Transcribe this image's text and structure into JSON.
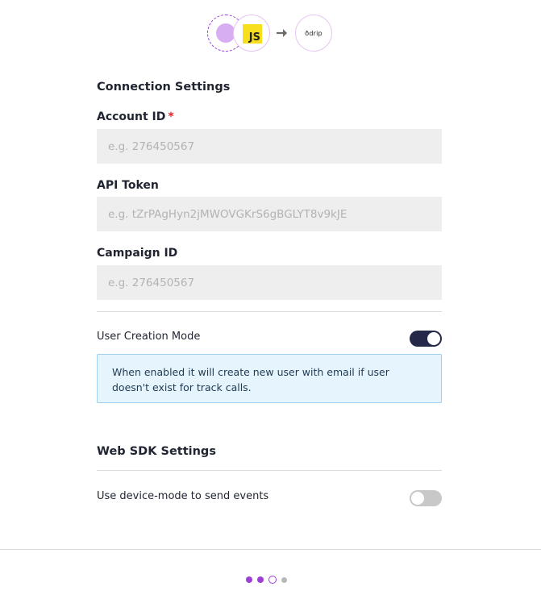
{
  "header": {
    "source_icon": "source-placeholder-icon",
    "source_badge": "JS",
    "arrow_icon": "arrow-right-icon",
    "destination_logo_text": "ðdrip"
  },
  "connection_settings": {
    "title": "Connection Settings",
    "account_id": {
      "label": "Account ID",
      "required_mark": "*",
      "value": "",
      "placeholder": "e.g. 276450567"
    },
    "api_token": {
      "label": "API Token",
      "value": "",
      "placeholder": "e.g. tZrPAgHyn2jMWOVGKrS6gBGLYT8v9kJE"
    },
    "campaign_id": {
      "label": "Campaign ID",
      "value": "",
      "placeholder": "e.g. 276450567"
    },
    "user_creation_mode": {
      "label": "User Creation Mode",
      "enabled": true,
      "info": "When enabled it will create new user with email if user doesn't exist for track calls."
    }
  },
  "web_sdk_settings": {
    "title": "Web SDK Settings",
    "device_mode": {
      "label": "Use device-mode to send events",
      "enabled": false
    }
  },
  "stepper": {
    "steps": [
      "done",
      "done",
      "current",
      "pending"
    ]
  },
  "colors": {
    "accent": "#9b3fd6",
    "toggle_on": "#26284a",
    "toggle_off": "#c8c8c8",
    "required": "#e0202a",
    "info_bg": "#e6f4fd",
    "info_border": "#9fd0f0"
  }
}
